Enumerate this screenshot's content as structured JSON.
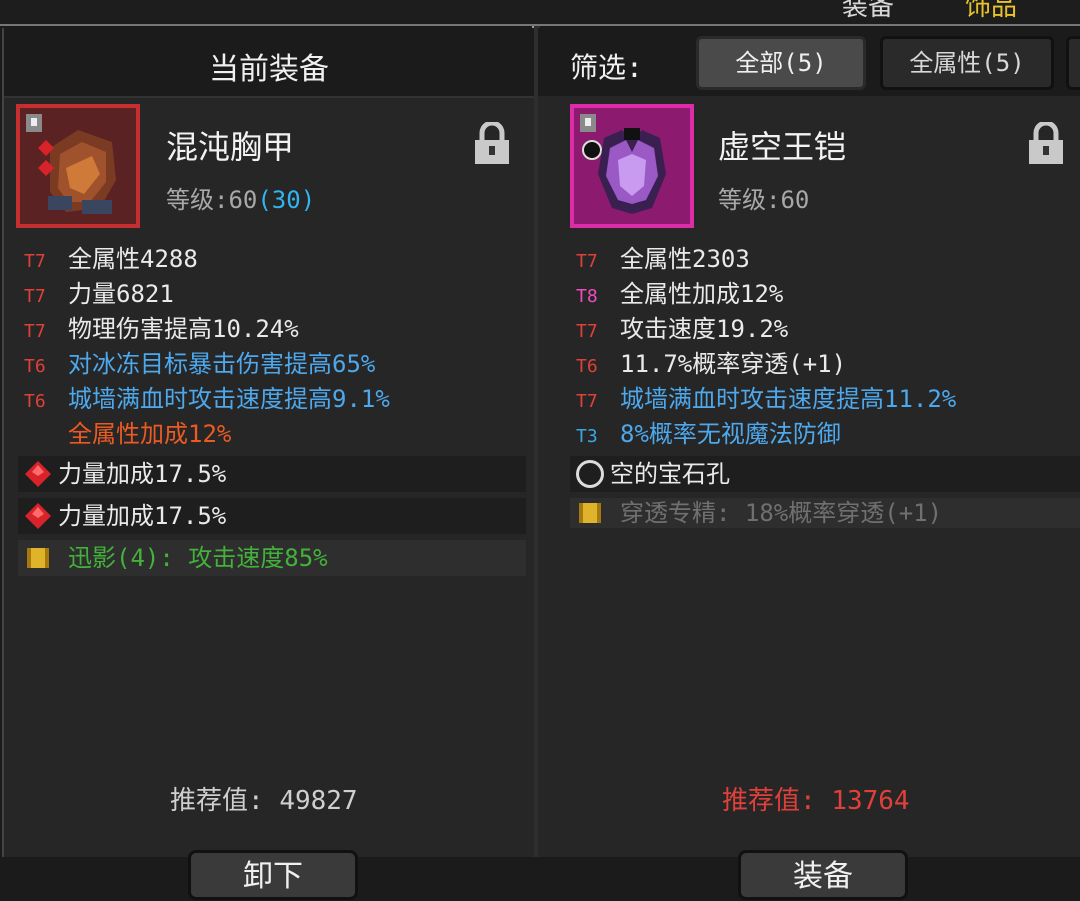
{
  "top_bar": {
    "tab_a": "装备",
    "tab_b": "饰品"
  },
  "left": {
    "title": "当前装备",
    "item": {
      "name": "混沌胸甲",
      "level_label": "等级:",
      "level": "60",
      "level_bonus": "(30)",
      "border_color": "#c62f2f"
    },
    "stats": [
      {
        "tier": "T7",
        "text": "全属性4288",
        "color": "white"
      },
      {
        "tier": "T7",
        "text": "力量6821",
        "color": "white"
      },
      {
        "tier": "T7",
        "text": "物理伤害提高10.24%",
        "color": "white"
      },
      {
        "tier": "T6",
        "text": "对冰冻目标暴击伤害提高65%",
        "color": "blue"
      },
      {
        "tier": "T6",
        "text": "城墙满血时攻击速度提高9.1%",
        "color": "blue"
      },
      {
        "tier": "",
        "text": "全属性加成12%",
        "color": "orange"
      }
    ],
    "gems": [
      {
        "icon": "red-gem-icon",
        "text": "力量加成17.5%"
      },
      {
        "icon": "red-gem-icon",
        "text": "力量加成17.5%"
      }
    ],
    "set_bonus": {
      "icon": "scroll-icon",
      "text": "迅影(4): 攻击速度85%"
    },
    "recommend_label": "推荐值:",
    "recommend_value": "49827",
    "action_button": "卸下"
  },
  "right": {
    "filter_label": "筛选:",
    "filters": [
      {
        "label": "全部(5)",
        "active": true
      },
      {
        "label": "全属性(5)",
        "active": false
      }
    ],
    "item": {
      "name": "虚空王铠",
      "level_label": "等级:",
      "level": "60",
      "border_color": "#dd2ca8"
    },
    "stats": [
      {
        "tier": "T7",
        "text": "全属性2303",
        "color": "white"
      },
      {
        "tier": "T8",
        "text": "全属性加成12%",
        "color": "white"
      },
      {
        "tier": "T7",
        "text": "攻击速度19.2%",
        "color": "white"
      },
      {
        "tier": "T6",
        "text": "11.7%概率穿透(+1)",
        "color": "white"
      },
      {
        "tier": "T7",
        "text": "城墙满血时攻击速度提高11.2%",
        "color": "blue"
      },
      {
        "tier": "T3",
        "text": "8%概率无视魔法防御",
        "color": "blue"
      }
    ],
    "socket": {
      "icon": "empty-socket-icon",
      "text": "空的宝石孔"
    },
    "set_bonus": {
      "icon": "scroll-icon",
      "text": "穿透专精: 18%概率穿透(+1)"
    },
    "recommend_label": "推荐值:",
    "recommend_value": "13764",
    "action_button": "装备"
  },
  "colors": {
    "tier_red": "#e0403a",
    "tier_pink": "#ef4dbd",
    "tier_blue": "#3aa7e3",
    "affix_blue": "#4da8ec",
    "affix_orange": "#ec5a24",
    "set_green": "#43b23a",
    "level_bonus": "#2fb6f2"
  }
}
